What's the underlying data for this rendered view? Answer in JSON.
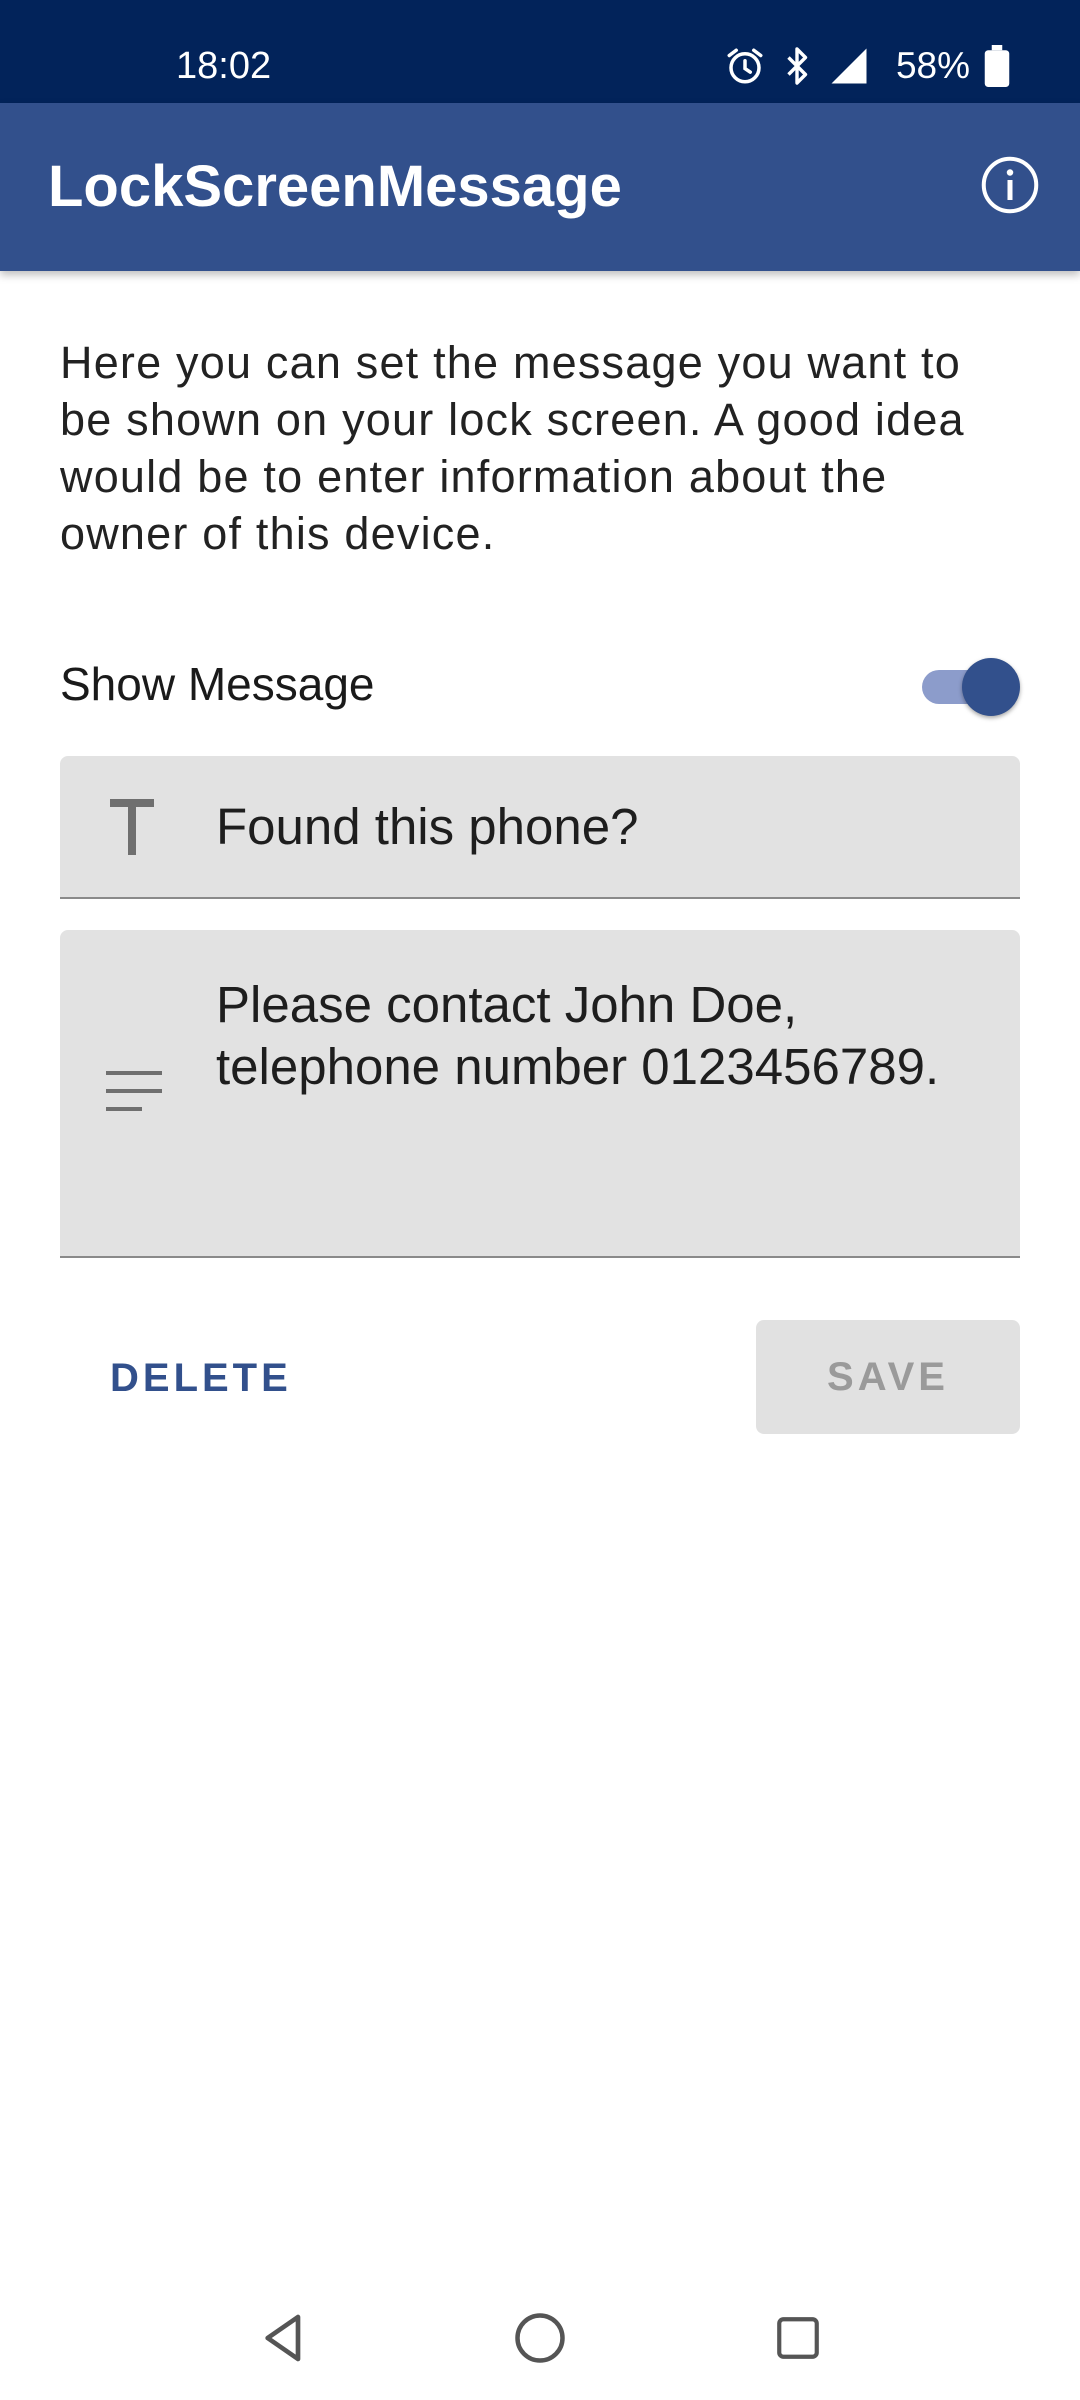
{
  "status_bar": {
    "time": "18:02",
    "battery": "58%",
    "icons": [
      "alarm-icon",
      "bluetooth-icon",
      "signal-icon",
      "battery-icon"
    ]
  },
  "app_bar": {
    "title": "LockScreenMessage",
    "info_icon": "info-icon",
    "color": "#32508c"
  },
  "description": "Here you can set the message you want to be shown on your lock screen. A good idea would be to enter information about the owner of this device.",
  "show_message": {
    "label": "Show Message",
    "enabled": true
  },
  "title_field": {
    "icon": "text-title-icon",
    "value": "Found this phone?"
  },
  "message_field": {
    "icon": "notes-icon",
    "value": "Please contact John Doe, telephone number 0123456789."
  },
  "buttons": {
    "delete_label": "DELETE",
    "save_label": "SAVE"
  },
  "nav_bar": {
    "icons": [
      "back-icon",
      "home-icon",
      "recents-icon"
    ]
  }
}
